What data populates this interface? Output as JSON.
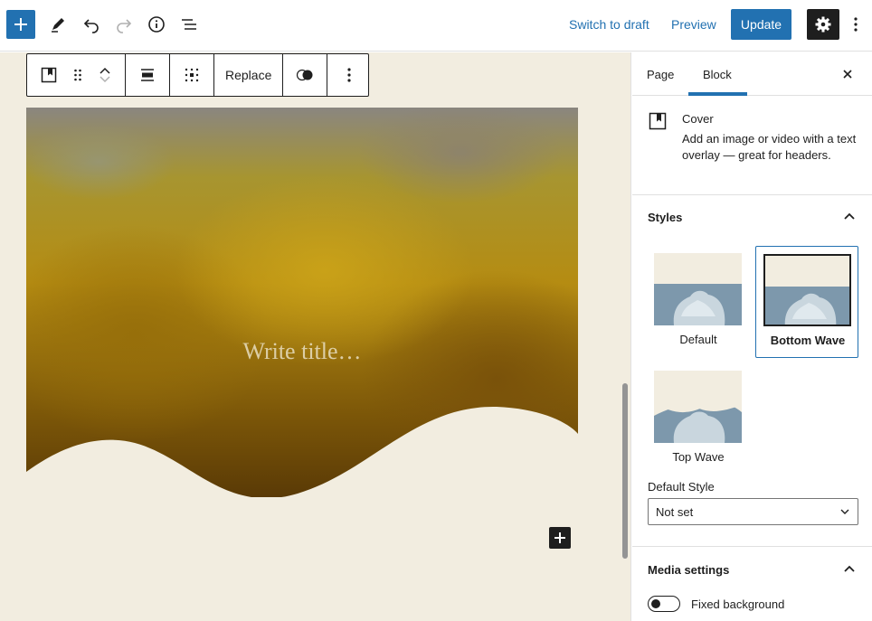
{
  "topbar": {
    "switch_to_draft": "Switch to draft",
    "preview": "Preview",
    "update": "Update"
  },
  "block_toolbar": {
    "replace": "Replace"
  },
  "cover": {
    "title_placeholder": "Write title…"
  },
  "sidebar": {
    "tabs": [
      {
        "label": "Page",
        "active": false
      },
      {
        "label": "Block",
        "active": true
      }
    ],
    "block_card": {
      "title": "Cover",
      "description": "Add an image or video with a text overlay — great for headers."
    },
    "styles_panel": {
      "title": "Styles",
      "options": [
        {
          "label": "Default",
          "selected": false
        },
        {
          "label": "Bottom Wave",
          "selected": true
        },
        {
          "label": "Top Wave",
          "selected": false
        }
      ],
      "default_style_label": "Default Style",
      "default_style_value": "Not set"
    },
    "media_panel": {
      "title": "Media settings",
      "fixed_background_label": "Fixed background",
      "fixed_background": false
    }
  },
  "colors": {
    "accent": "#2271b1",
    "canvas_bg": "#f2ede0",
    "dark": "#1e1e1e"
  }
}
